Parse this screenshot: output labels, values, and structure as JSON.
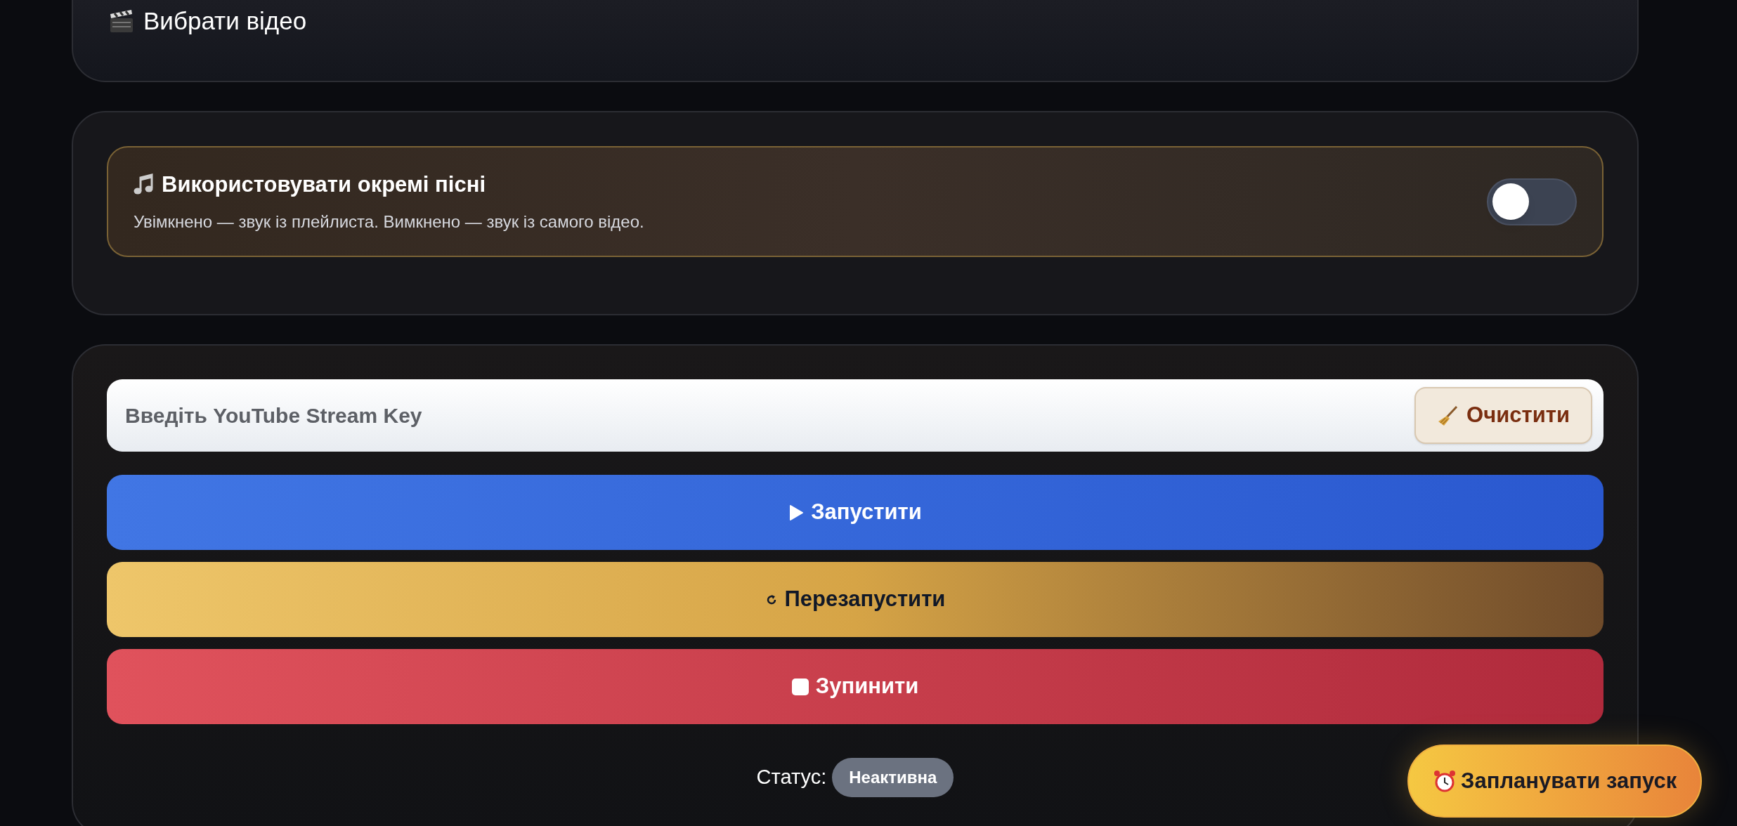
{
  "video_card": {
    "title": "Вибрати відео"
  },
  "songs_toggle": {
    "title": "Використовувати окремі пісні",
    "description": "Увімкнено — звук із плейлиста. Вимкнено — звук із самого відео.",
    "on": false
  },
  "stream_key": {
    "placeholder": "Введіть YouTube Stream Key",
    "clear_button": "Очистити"
  },
  "actions": [
    {
      "kind": "start",
      "label": "Запустити"
    },
    {
      "kind": "restart",
      "label": "Перезапустити"
    },
    {
      "kind": "stop",
      "label": "Зупинити"
    }
  ],
  "status": {
    "label": "Статус:",
    "value": "Неактивна"
  },
  "schedule_button": "Запланувати запуск"
}
